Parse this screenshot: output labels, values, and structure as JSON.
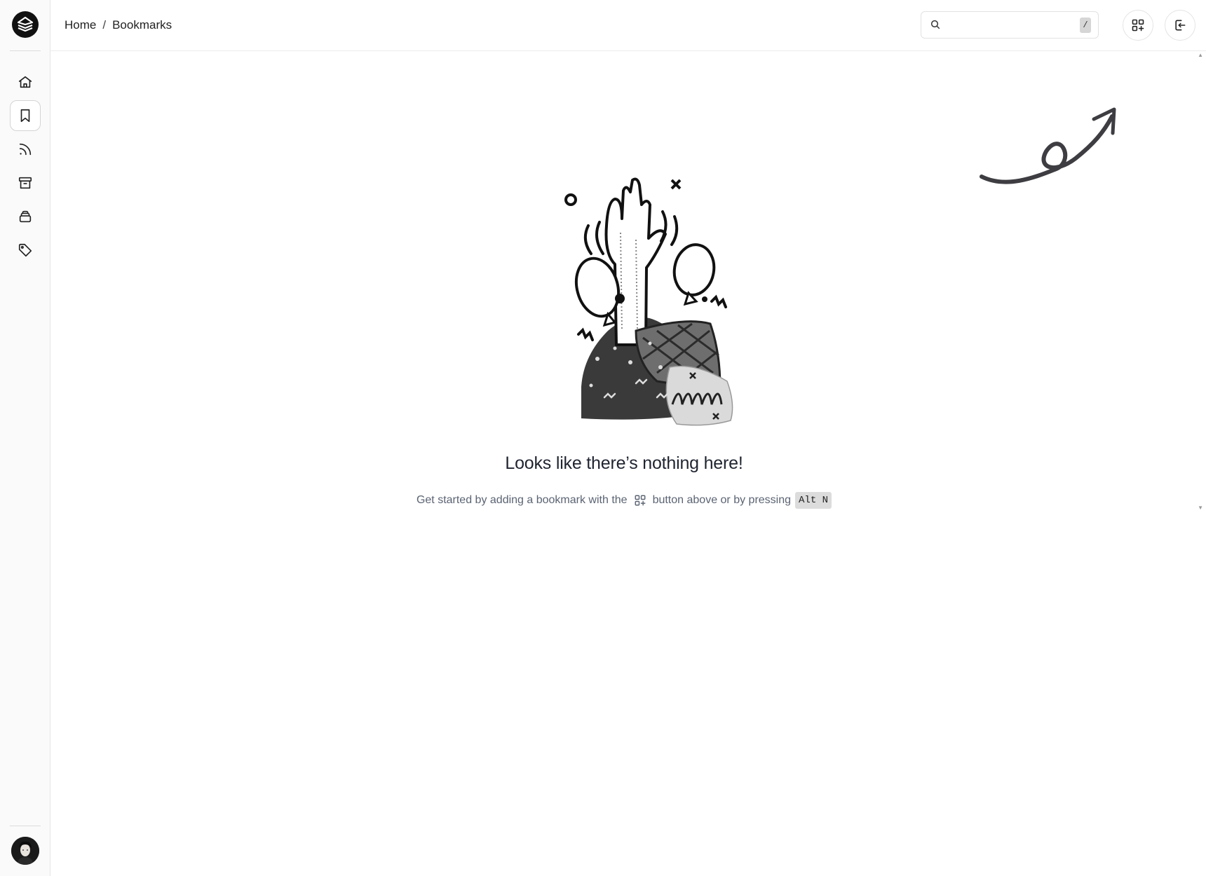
{
  "sidebar": {
    "logo_icon": "layers-logo-icon",
    "items": [
      {
        "name": "home",
        "icon": "home-icon"
      },
      {
        "name": "bookmarks",
        "icon": "bookmark-icon",
        "active": true
      },
      {
        "name": "feeds",
        "icon": "rss-icon"
      },
      {
        "name": "archive",
        "icon": "archive-icon"
      },
      {
        "name": "collections",
        "icon": "stack-icon"
      },
      {
        "name": "tags",
        "icon": "tag-icon"
      }
    ],
    "avatar": "user-avatar"
  },
  "header": {
    "breadcrumb": {
      "home": "Home",
      "separator": "/",
      "current": "Bookmarks"
    },
    "search": {
      "placeholder": "",
      "value": "",
      "shortcut": "/"
    },
    "buttons": {
      "add": "add-bookmark-icon",
      "logout": "logout-icon"
    }
  },
  "empty_state": {
    "title": "Looks like there’s nothing here!",
    "subtitle_before": "Get started by adding a bookmark with the",
    "subtitle_after": "button above or by pressing",
    "shortcut": "Alt N"
  },
  "colors": {
    "sidebar_bg": "#fafafa",
    "accent": "#111111",
    "muted_text": "#5b6473",
    "kbd_bg": "#dcdcdc"
  }
}
